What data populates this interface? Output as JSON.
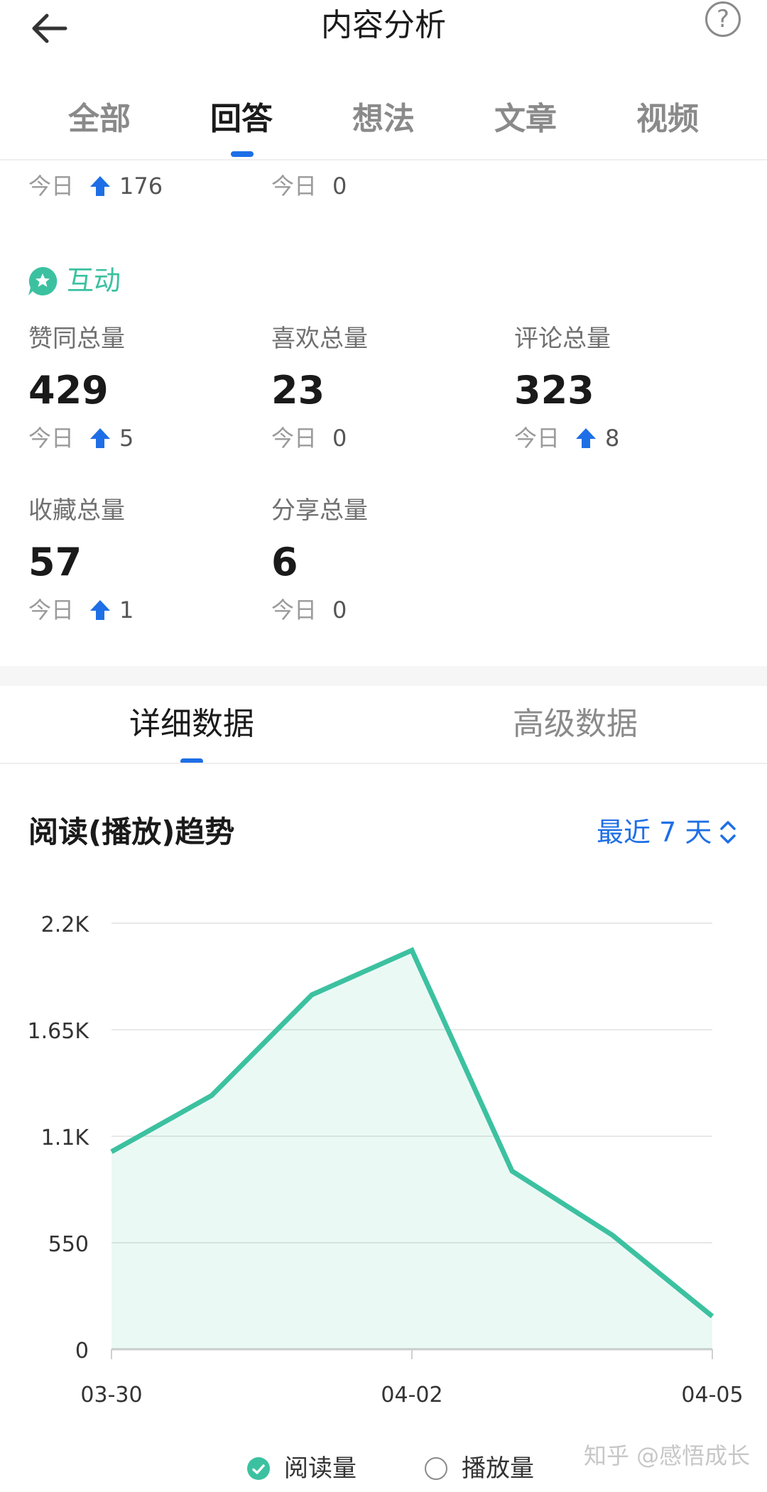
{
  "header": {
    "title": "内容分析",
    "help_icon": "question-circle-icon",
    "back_icon": "arrow-left-icon"
  },
  "tabs": [
    {
      "label": "全部",
      "active": false
    },
    {
      "label": "回答",
      "active": true
    },
    {
      "label": "想法",
      "active": false
    },
    {
      "label": "文章",
      "active": false
    },
    {
      "label": "视频",
      "active": false
    }
  ],
  "partial_row": [
    {
      "today_label": "今日",
      "trend": "up",
      "today_value": "176"
    },
    {
      "today_label": "今日",
      "trend": "none",
      "today_value": "0"
    }
  ],
  "interaction": {
    "title": "互动",
    "stats": [
      {
        "label": "赞同总量",
        "value": "429",
        "today_label": "今日",
        "trend": "up",
        "today_value": "5"
      },
      {
        "label": "喜欢总量",
        "value": "23",
        "today_label": "今日",
        "trend": "none",
        "today_value": "0"
      },
      {
        "label": "评论总量",
        "value": "323",
        "today_label": "今日",
        "trend": "up",
        "today_value": "8"
      },
      {
        "label": "收藏总量",
        "value": "57",
        "today_label": "今日",
        "trend": "up",
        "today_value": "1"
      },
      {
        "label": "分享总量",
        "value": "6",
        "today_label": "今日",
        "trend": "none",
        "today_value": "0"
      }
    ]
  },
  "detail_tabs": [
    {
      "label": "详细数据",
      "active": true
    },
    {
      "label": "高级数据",
      "active": false
    }
  ],
  "trend": {
    "title": "阅读(播放)趋势",
    "range_label": "最近 7 天"
  },
  "chart_data": {
    "type": "area",
    "x": [
      "03-30",
      "03-31",
      "04-01",
      "04-02",
      "04-03",
      "04-04",
      "04-05"
    ],
    "x_tick_labels": [
      "03-30",
      "04-02",
      "04-05"
    ],
    "y_tick_labels": [
      "0",
      "550",
      "1.1K",
      "1.65K",
      "2.2K"
    ],
    "y_ticks": [
      0,
      550,
      1100,
      1650,
      2200
    ],
    "ylim": [
      0,
      2200
    ],
    "series": [
      {
        "name": "阅读量",
        "values": [
          1020,
          1310,
          1830,
          2060,
          920,
          590,
          170
        ],
        "color": "#3cc1a0",
        "selected": true
      }
    ],
    "grid": true
  },
  "legend": [
    {
      "label": "阅读量",
      "checked": true
    },
    {
      "label": "播放量",
      "checked": false
    }
  ],
  "watermark": "知乎 @感悟成长",
  "colors": {
    "accent": "#1e6fe6",
    "teal": "#3cc1a0",
    "up_arrow": "#1e6fe6"
  }
}
